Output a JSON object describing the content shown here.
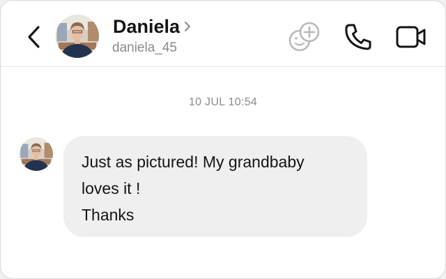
{
  "header": {
    "contact_name": "Daniela",
    "username": "daniela_45",
    "icons": {
      "back": "chevron-left-icon",
      "profile_chevron": "chevron-right-icon",
      "add_friend": "add-friend-icon",
      "call": "phone-icon",
      "video": "video-camera-icon"
    }
  },
  "conversation": {
    "timestamp": "10 JUL 10:54",
    "messages": [
      {
        "sender": "Daniela",
        "lines": [
          "Just as pictured! My grandbaby",
          "loves it !",
          "Thanks"
        ]
      }
    ]
  },
  "colors": {
    "background": "#ffffff",
    "bubble": "#efefef",
    "text": "#141414",
    "muted_text": "#8a8a8a",
    "add_friend_icon": "#b9b9b9"
  }
}
